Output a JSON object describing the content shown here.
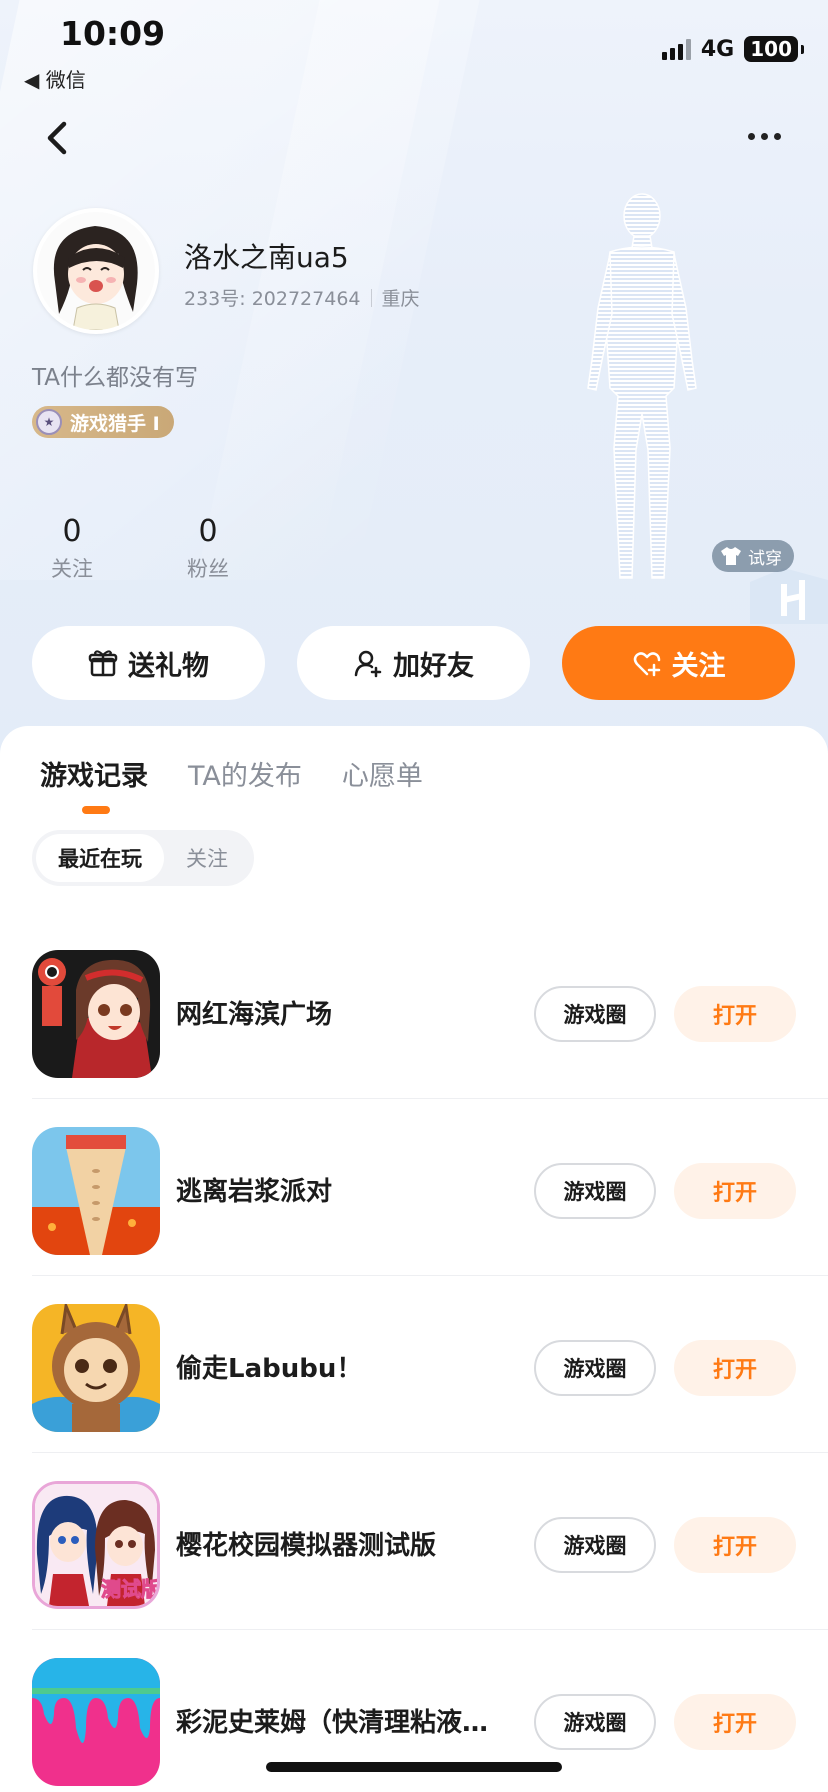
{
  "status_bar": {
    "time": "10:09",
    "back_app": "◀ 微信",
    "network": "4G",
    "battery": "100"
  },
  "profile": {
    "name": "洛水之南ua5",
    "id_text": "233号: 202727464",
    "location": "重庆",
    "bio": "TA什么都没有写",
    "badge": "游戏猎手 Ⅰ",
    "stats": [
      {
        "value": "0",
        "label": "关注"
      },
      {
        "value": "0",
        "label": "粉丝"
      }
    ],
    "try_on": "试穿"
  },
  "actions": {
    "gift": "送礼物",
    "add_friend": "加好友",
    "follow": "关注"
  },
  "tabs": [
    {
      "label": "游戏记录"
    },
    {
      "label": "TA的发布"
    },
    {
      "label": "心愿单"
    }
  ],
  "subtabs": [
    {
      "label": "最近在玩"
    },
    {
      "label": "关注"
    }
  ],
  "games": [
    {
      "name": "网红海滨广场",
      "circle": "游戏圈",
      "open": "打开"
    },
    {
      "name": "逃离岩浆派对",
      "circle": "游戏圈",
      "open": "打开"
    },
    {
      "name": "偷走Labubu！",
      "circle": "游戏圈",
      "open": "打开"
    },
    {
      "name": "樱花校园模拟器测试版",
      "circle": "游戏圈",
      "open": "打开",
      "icon_text": "测试版"
    },
    {
      "name": "彩泥史莱姆（快清理粘液…",
      "circle": "游戏圈",
      "open": "打开"
    }
  ],
  "colors": {
    "accent": "#ff7a14",
    "open_bg": "#fff2e8",
    "header_bg": "#e7eef9"
  }
}
